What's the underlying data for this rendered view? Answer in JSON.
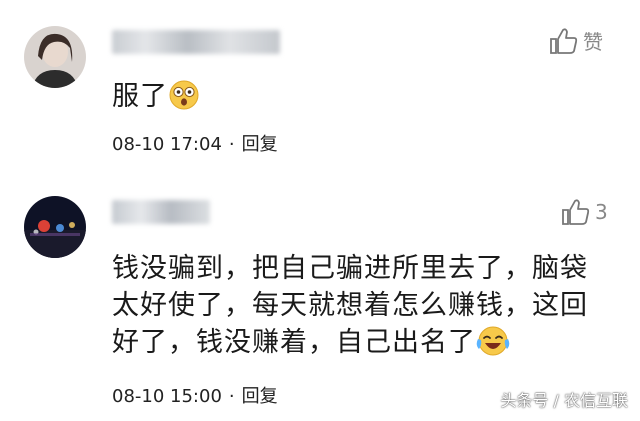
{
  "comments": [
    {
      "text": "服了",
      "emoji": "astonished-face",
      "time": "08-10 17:04",
      "separator": "·",
      "reply_label": "回复",
      "like_label": "赞"
    },
    {
      "text_lines": [
        "钱没骗到，把自己骗进所里去了，脑袋",
        "太好使了，每天就想着怎么赚钱，这回",
        "好了，钱没赚着，自己出名了"
      ],
      "emoji": "laughing-tears-face",
      "time": "08-10 15:00",
      "separator": "·",
      "reply_label": "回复",
      "like_count": "3"
    }
  ],
  "watermark": "头条号 / 农信互联",
  "icons": {
    "like": "thumbs-up-icon"
  }
}
